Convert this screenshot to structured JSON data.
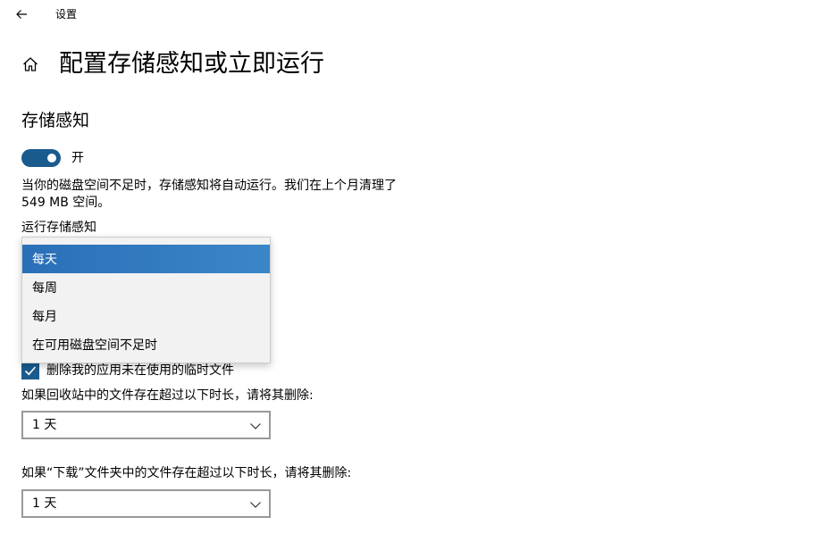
{
  "titlebar": {
    "app_title": "设置"
  },
  "header": {
    "page_title": "配置存储感知或立即运行"
  },
  "storage_sense": {
    "section_title": "存储感知",
    "toggle_label": "开",
    "toggle_on": true,
    "description": "当你的磁盘空间不足时，存储感知将自动运行。我们在上个月清理了 549 MB 空间。",
    "run_label": "运行存储感知",
    "run_options": [
      "每天",
      "每周",
      "每月",
      "在可用磁盘空间不足时"
    ],
    "run_selected": "每天"
  },
  "temp_files": {
    "checkbox_label": "删除我的应用未在使用的临时文件",
    "checked": true
  },
  "recycle_bin": {
    "label": "如果回收站中的文件存在超过以下时长，请将其删除:",
    "value": "1 天"
  },
  "downloads": {
    "label": "如果“下载”文件夹中的文件存在超过以下时长，请将其删除:",
    "value": "1 天"
  },
  "colors": {
    "accent": "#1a5b8e",
    "selection": "#2a6fb7"
  },
  "icons": {
    "back": "back-arrow-icon",
    "home": "home-icon",
    "check": "checkmark-icon",
    "chevron": "chevron-down-icon"
  }
}
